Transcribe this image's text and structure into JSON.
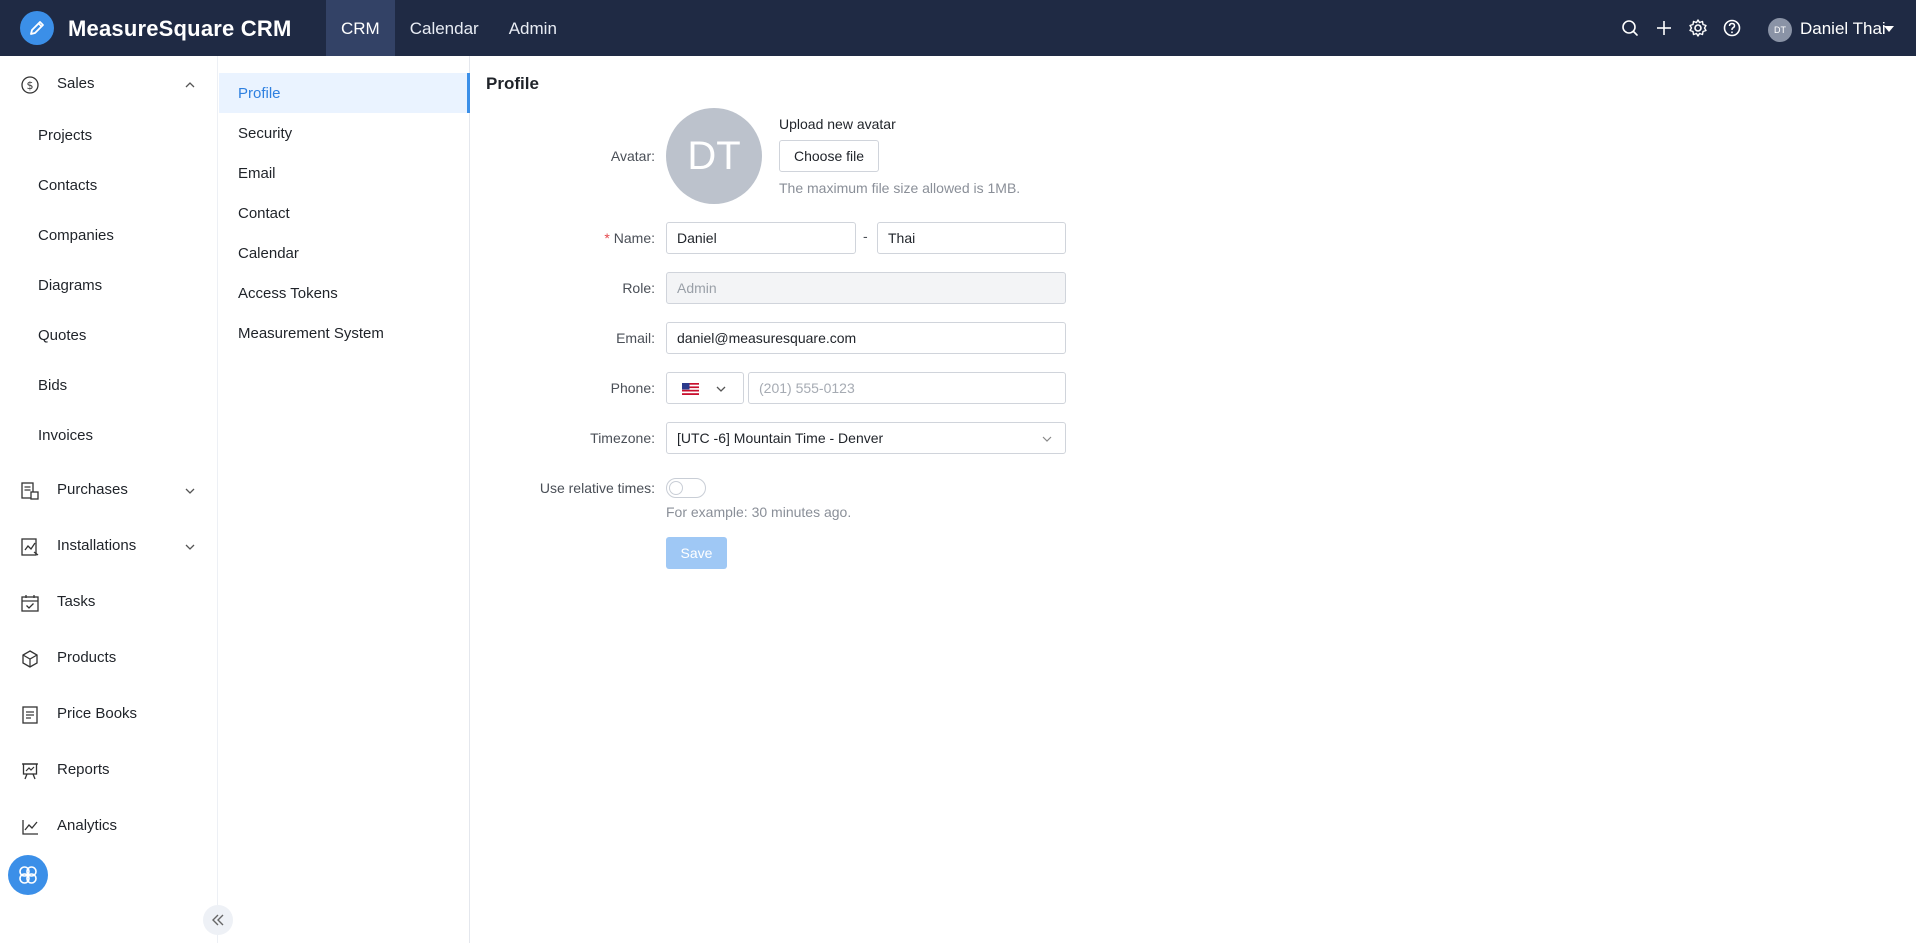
{
  "app": {
    "brand": "MeasureSquare CRM",
    "accent_color": "#3b8fe8",
    "topbar_color": "#1f2a44"
  },
  "topnav": {
    "items": [
      {
        "label": "CRM",
        "active": true
      },
      {
        "label": "Calendar",
        "active": false
      },
      {
        "label": "Admin",
        "active": false
      }
    ]
  },
  "topbar_icons": [
    "search-icon",
    "plus-icon",
    "gear-icon",
    "help-icon"
  ],
  "user": {
    "initials": "DT",
    "name": "Daniel Thai"
  },
  "sidebar": {
    "sales": {
      "label": "Sales",
      "icon": "dollar-icon",
      "expanded": true
    },
    "sales_children": [
      "Projects",
      "Contacts",
      "Companies",
      "Diagrams",
      "Quotes",
      "Bids",
      "Invoices"
    ],
    "items": [
      {
        "label": "Purchases",
        "icon": "purchase-icon",
        "expandable": true
      },
      {
        "label": "Installations",
        "icon": "installation-icon",
        "expandable": true
      },
      {
        "label": "Tasks",
        "icon": "calendar-check-icon",
        "expandable": false
      },
      {
        "label": "Products",
        "icon": "box-icon",
        "expandable": false
      },
      {
        "label": "Price Books",
        "icon": "document-icon",
        "expandable": false
      },
      {
        "label": "Reports",
        "icon": "presentation-icon",
        "expandable": false
      },
      {
        "label": "Analytics",
        "icon": "line-chart-icon",
        "expandable": false
      }
    ]
  },
  "settings_nav": {
    "items": [
      {
        "label": "Profile",
        "active": true
      },
      {
        "label": "Security",
        "active": false
      },
      {
        "label": "Email",
        "active": false
      },
      {
        "label": "Contact",
        "active": false
      },
      {
        "label": "Calendar",
        "active": false
      },
      {
        "label": "Access Tokens",
        "active": false
      },
      {
        "label": "Measurement System",
        "active": false
      }
    ]
  },
  "profile": {
    "title": "Profile",
    "avatar": {
      "label": "Avatar:",
      "initials": "DT",
      "upload_title": "Upload new avatar",
      "choose_label": "Choose file",
      "hint": "The maximum file size allowed is 1MB."
    },
    "name": {
      "required_mark": "*",
      "label": "Name:",
      "first": "Daniel",
      "separator": "-",
      "last": "Thai"
    },
    "role": {
      "label": "Role:",
      "value": "Admin"
    },
    "email": {
      "label": "Email:",
      "value": "daniel@measuresquare.com"
    },
    "phone": {
      "label": "Phone:",
      "country": "US",
      "placeholder": "(201) 555-0123",
      "value": ""
    },
    "timezone": {
      "label": "Timezone:",
      "value": "[UTC -6] Mountain Time - Denver"
    },
    "relative_times": {
      "label": "Use relative times:",
      "enabled": false,
      "hint": "For example: 30 minutes ago."
    },
    "save_label": "Save"
  }
}
